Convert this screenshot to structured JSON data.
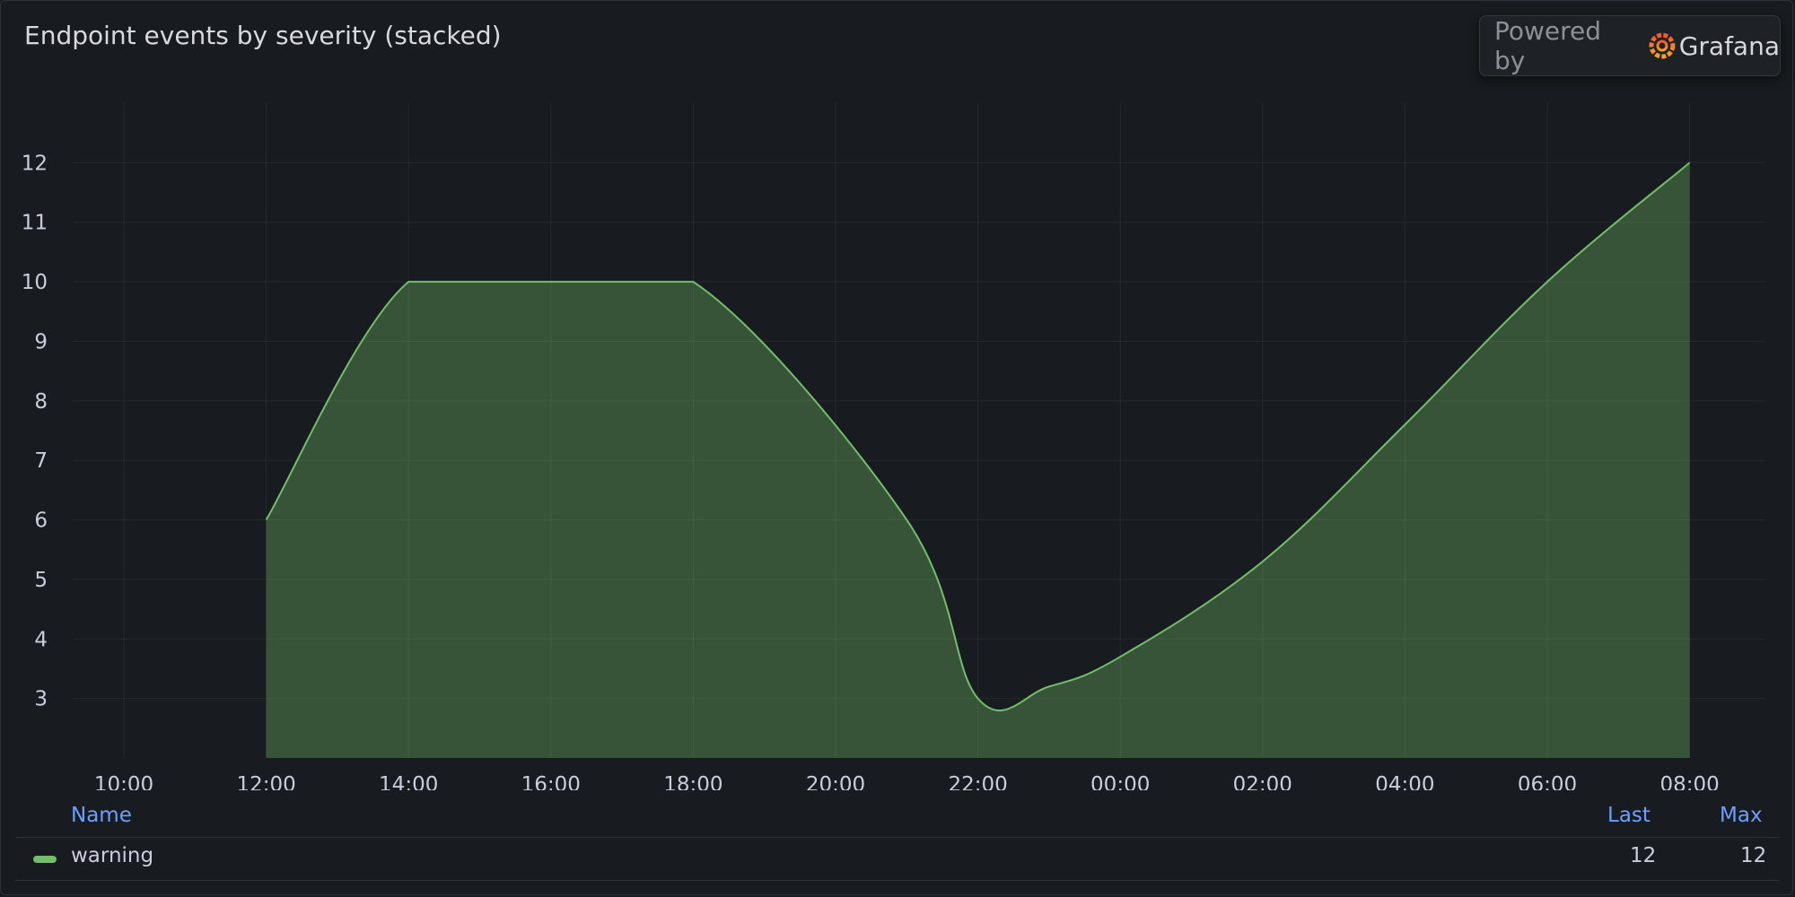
{
  "panel": {
    "title": "Endpoint events by severity (stacked)",
    "badge": {
      "prefix": "Powered by",
      "brand": "Grafana"
    }
  },
  "chart_data": {
    "type": "area",
    "title": "Endpoint events by severity (stacked)",
    "x_ticks": [
      "10:00",
      "12:00",
      "14:00",
      "16:00",
      "18:00",
      "20:00",
      "22:00",
      "00:00",
      "02:00",
      "04:00",
      "06:00",
      "08:00"
    ],
    "y_ticks": [
      3,
      4,
      5,
      6,
      7,
      8,
      9,
      10,
      11,
      12
    ],
    "y_range": [
      2,
      13
    ],
    "grid": true,
    "legend_placement": "bottom",
    "series": [
      {
        "name": "warning",
        "color": "#73bf69",
        "x": [
          "12:00",
          "14:00",
          "16:00",
          "18:00",
          "21:00",
          "22:00",
          "23:00",
          "00:00",
          "02:00",
          "04:00",
          "06:00",
          "08:00"
        ],
        "values": [
          6,
          10,
          10,
          10,
          6,
          3,
          3.2,
          3.7,
          5.3,
          7.6,
          10,
          12
        ]
      }
    ]
  },
  "legend": {
    "headers": {
      "name": "Name",
      "last": "Last",
      "max": "Max"
    },
    "rows": [
      {
        "name": "warning",
        "last": "12",
        "max": "12",
        "color": "#73bf69"
      }
    ]
  }
}
